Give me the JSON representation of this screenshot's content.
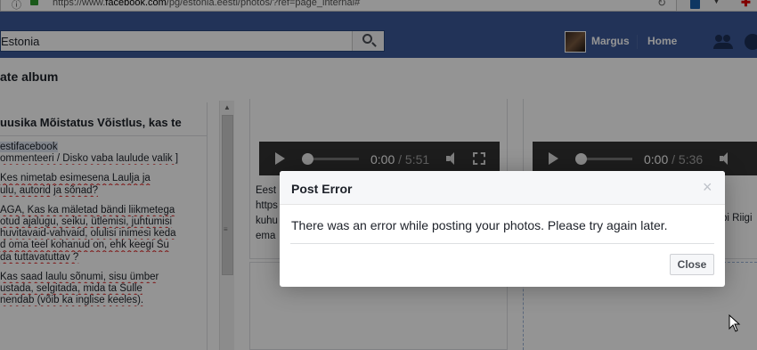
{
  "browser": {
    "url_prefix": "https://www.",
    "url_host": "facebook.com",
    "url_path": "/pg/estonia.eesti/photos/?ref=page_internal#"
  },
  "fb_header": {
    "search_value": "Estonia",
    "user_name": "Margus",
    "home_label": "Home"
  },
  "page": {
    "album_title": "ate album",
    "left_card": {
      "title": "uusika Mõistatus Võistlus, kas te",
      "lines": [
        "estifacebook",
        "ommenteeri  / Disko vaba laulude valik  ]",
        "",
        "Kes nimetab esimesena  Laulja ja",
        "ulu, autorid ja  sõnad?",
        "",
        "AGA, Kas ka mäletad bändi liikmetega",
        "otud ajalugu, seiku, ütlemisi,  juhtumisi",
        " huvitavaid-vahvaid, olulisi inimesi keda",
        "d oma teel kohanud on, ehk keegi Su",
        "da   tuttavatuttav ?",
        "",
        "Kas saad laulu sõnumi, sisu ümber",
        "ustada, selgitada, mida ta Sulle",
        "nendab (võib ka inglise keeles)."
      ]
    },
    "photo_cards": [
      {
        "time_current": "0:00",
        "time_duration": "/ 5:51",
        "text_lines": [
          "Eest",
          "https",
          "kuhu",
          "ema"
        ]
      },
      {
        "time_current": "0:00",
        "time_duration": "/ 5:36",
        "text_right": "bi Riigi"
      }
    ]
  },
  "dialog": {
    "title": "Post Error",
    "close_x": "×",
    "message": "There was an error while posting your photos. Please try again later.",
    "close_button": "Close"
  }
}
